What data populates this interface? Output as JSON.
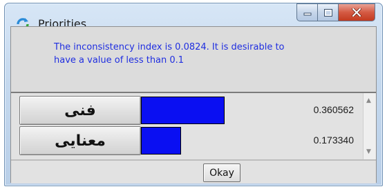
{
  "window": {
    "title": "Priorities",
    "icon": "refresh-arrows-icon"
  },
  "caption_buttons": {
    "minimize_icon": "minimize-icon",
    "maximize_icon": "maximize-icon",
    "close_icon": "close-icon",
    "close_color": "#c7422b"
  },
  "message": {
    "text": "The inconsistency index is 0.0824.  It is desirable to have a value of less than 0.1",
    "color": "#1f2ee0"
  },
  "priorities": [
    {
      "name": "فنی",
      "value": "0.360562",
      "weight": 0.360562
    },
    {
      "name": "معنایی",
      "value": "0.173340",
      "weight": 0.17334
    }
  ],
  "bar_color": "#0a0ff2",
  "scrollbar": {
    "up_icon": "scroll-up-arrow-icon",
    "down_icon": "scroll-down-arrow-icon"
  },
  "footer": {
    "okay_label": "Okay"
  }
}
